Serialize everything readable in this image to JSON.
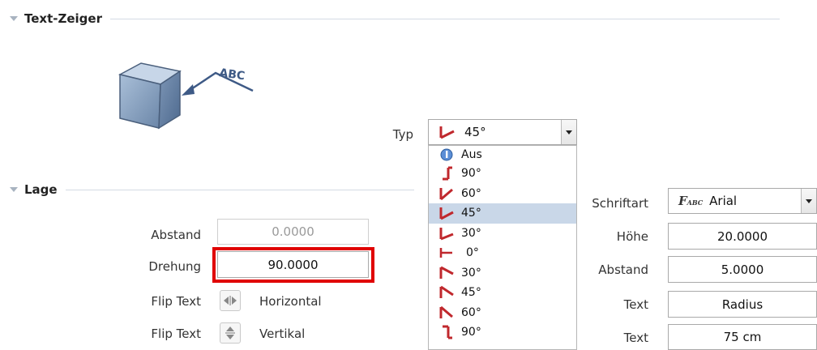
{
  "sections": {
    "text_zeiger": "Text-Zeiger",
    "lage": "Lage"
  },
  "illustration": {
    "label": "ABC"
  },
  "typ": {
    "label": "Typ",
    "selected": "45°",
    "options": [
      {
        "label": "Aus",
        "icon": "off-icon"
      },
      {
        "label": "90°",
        "icon": "leader-90-icon"
      },
      {
        "label": "60°",
        "icon": "leader-60-icon"
      },
      {
        "label": "45°",
        "icon": "leader-45-icon",
        "selected": true
      },
      {
        "label": "30°",
        "icon": "leader-30-icon"
      },
      {
        "label": "0°",
        "icon": "leader-0-icon"
      },
      {
        "label": "30°",
        "icon": "leader-30-down-icon"
      },
      {
        "label": "45°",
        "icon": "leader-45-down-icon"
      },
      {
        "label": "60°",
        "icon": "leader-60-down-icon"
      },
      {
        "label": "90°",
        "icon": "leader-90-down-icon"
      }
    ]
  },
  "lage": {
    "abstand_label": "Abstand",
    "abstand_value": "0.0000",
    "drehung_label": "Drehung",
    "drehung_value": "90.0000",
    "flip1_label": "Flip Text",
    "flip1_value": "Horizontal",
    "flip2_label": "Flip Text",
    "flip2_value": "Vertikal"
  },
  "font": {
    "schriftart_label": "Schriftart",
    "schriftart_value": "Arial",
    "hoehe_label": "Höhe",
    "hoehe_value": "20.0000",
    "abstand_label": "Abstand",
    "abstand_value": "5.0000",
    "text1_label": "Text",
    "text1_value": "Radius",
    "text2_label": "Text",
    "text2_value": "75 cm"
  },
  "colors": {
    "highlight": "#e00000",
    "accent_red": "#c0282d",
    "selection": "#c9d7e8"
  }
}
